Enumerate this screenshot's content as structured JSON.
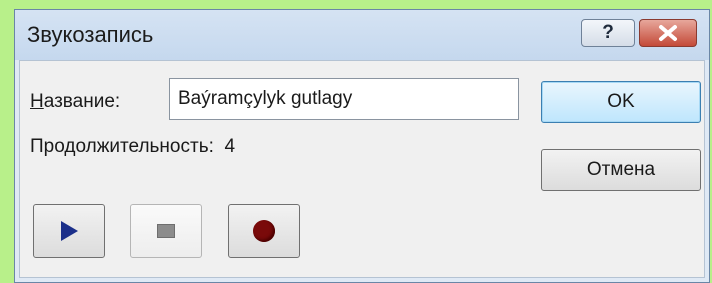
{
  "dialog": {
    "title": "Звукозапись",
    "help_label": "?",
    "name_label_accel": "Н",
    "name_label_rest": "азвание:",
    "name_value": "Baýramçylyk gutlagy",
    "duration_label": "Продолжительность:",
    "duration_value": "4",
    "ok_label": "OK",
    "cancel_label": "Отмена",
    "media_buttons": [
      "play-icon",
      "stop-icon",
      "record-icon"
    ]
  },
  "colors": {
    "background": "#b8f08a",
    "close_button": "#c44a38",
    "record": "#7a0a0a",
    "play": "#1b2f8a"
  }
}
